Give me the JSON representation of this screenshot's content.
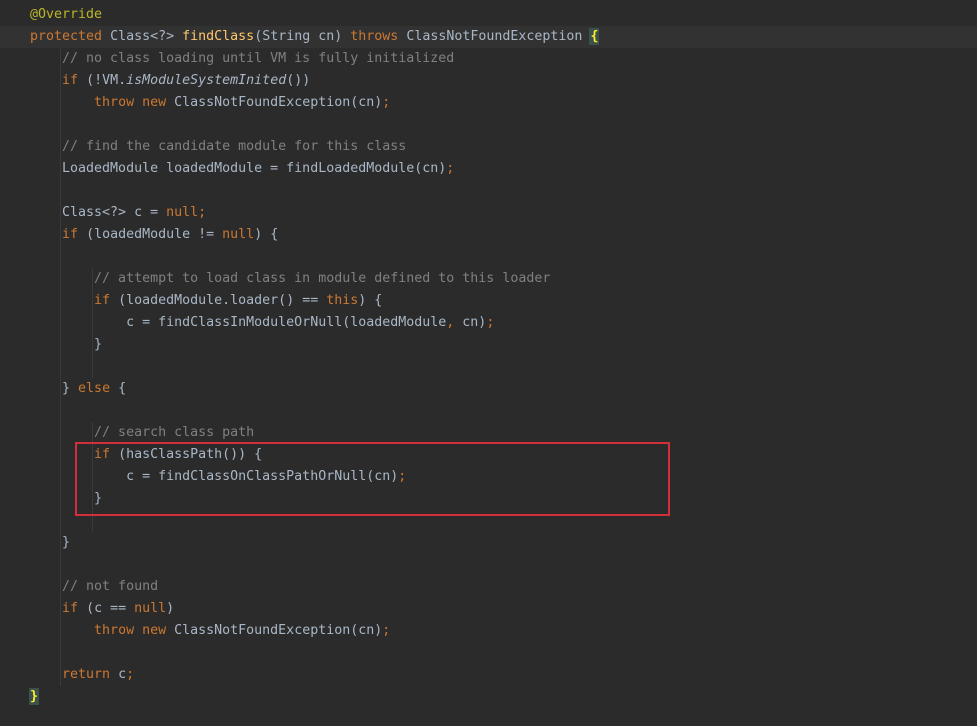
{
  "editor": {
    "lines": [
      [
        {
          "t": "@Override",
          "c": "tok-ann"
        }
      ],
      [
        {
          "t": "protected ",
          "c": "tok-kw"
        },
        {
          "t": "Class<?> ",
          "c": "tok-type"
        },
        {
          "t": "findClass",
          "c": "tok-fn"
        },
        {
          "t": "(String cn) ",
          "c": "tok-plain"
        },
        {
          "t": "throws ",
          "c": "tok-kw"
        },
        {
          "t": "ClassNotFoundException ",
          "c": "tok-plain"
        },
        {
          "t": "{",
          "c": "brace-match"
        }
      ],
      [
        {
          "t": "    // no class loading until VM is fully initialized",
          "c": "tok-cmt"
        }
      ],
      [
        {
          "t": "    ",
          "c": "tok-plain"
        },
        {
          "t": "if ",
          "c": "tok-kw"
        },
        {
          "t": "(!VM.",
          "c": "tok-plain"
        },
        {
          "t": "isModuleSystemInited",
          "c": "tok-plain tok-it"
        },
        {
          "t": "())",
          "c": "tok-plain"
        }
      ],
      [
        {
          "t": "        ",
          "c": "tok-plain"
        },
        {
          "t": "throw new ",
          "c": "tok-kw"
        },
        {
          "t": "ClassNotFoundException(cn)",
          "c": "tok-plain"
        },
        {
          "t": ";",
          "c": "tok-punct"
        }
      ],
      [],
      [
        {
          "t": "    // find the candidate module for this class",
          "c": "tok-cmt"
        }
      ],
      [
        {
          "t": "    LoadedModule loadedModule = findLoadedModule(cn)",
          "c": "tok-plain"
        },
        {
          "t": ";",
          "c": "tok-punct"
        }
      ],
      [],
      [
        {
          "t": "    Class<?> c = ",
          "c": "tok-plain"
        },
        {
          "t": "null;",
          "c": "tok-kw"
        }
      ],
      [
        {
          "t": "    ",
          "c": "tok-plain"
        },
        {
          "t": "if ",
          "c": "tok-kw"
        },
        {
          "t": "(loadedModule != ",
          "c": "tok-plain"
        },
        {
          "t": "null",
          "c": "tok-kw"
        },
        {
          "t": ") {",
          "c": "tok-plain"
        }
      ],
      [],
      [
        {
          "t": "        // attempt to load class in module defined to this loader",
          "c": "tok-cmt"
        }
      ],
      [
        {
          "t": "        ",
          "c": "tok-plain"
        },
        {
          "t": "if ",
          "c": "tok-kw"
        },
        {
          "t": "(loadedModule.loader() == ",
          "c": "tok-plain"
        },
        {
          "t": "this",
          "c": "tok-kw"
        },
        {
          "t": ") {",
          "c": "tok-plain"
        }
      ],
      [
        {
          "t": "            c = findClassInModuleOrNull(loadedModule",
          "c": "tok-plain"
        },
        {
          "t": ", ",
          "c": "tok-punct"
        },
        {
          "t": "cn)",
          "c": "tok-plain"
        },
        {
          "t": ";",
          "c": "tok-punct"
        }
      ],
      [
        {
          "t": "        }",
          "c": "tok-plain"
        }
      ],
      [],
      [
        {
          "t": "    } ",
          "c": "tok-plain"
        },
        {
          "t": "else ",
          "c": "tok-kw"
        },
        {
          "t": "{",
          "c": "tok-plain"
        }
      ],
      [],
      [
        {
          "t": "        // search class path",
          "c": "tok-cmt"
        }
      ],
      [
        {
          "t": "        ",
          "c": "tok-plain"
        },
        {
          "t": "if ",
          "c": "tok-kw"
        },
        {
          "t": "(hasClassPath()) {",
          "c": "tok-plain"
        }
      ],
      [
        {
          "t": "            c = findClassOnClassPathOrNull(cn)",
          "c": "tok-plain"
        },
        {
          "t": ";",
          "c": "tok-punct"
        }
      ],
      [
        {
          "t": "        }",
          "c": "tok-plain"
        }
      ],
      [],
      [
        {
          "t": "    }",
          "c": "tok-plain"
        }
      ],
      [],
      [
        {
          "t": "    // not found",
          "c": "tok-cmt"
        }
      ],
      [
        {
          "t": "    ",
          "c": "tok-plain"
        },
        {
          "t": "if ",
          "c": "tok-kw"
        },
        {
          "t": "(c == ",
          "c": "tok-plain"
        },
        {
          "t": "null",
          "c": "tok-kw"
        },
        {
          "t": ")",
          "c": "tok-plain"
        }
      ],
      [
        {
          "t": "        ",
          "c": "tok-plain"
        },
        {
          "t": "throw new ",
          "c": "tok-kw"
        },
        {
          "t": "ClassNotFoundException(cn)",
          "c": "tok-plain"
        },
        {
          "t": ";",
          "c": "tok-punct"
        }
      ],
      [],
      [
        {
          "t": "    ",
          "c": "tok-plain"
        },
        {
          "t": "return ",
          "c": "tok-kw"
        },
        {
          "t": "c",
          "c": "tok-plain"
        },
        {
          "t": ";",
          "c": "tok-punct"
        }
      ],
      [
        {
          "t": "}",
          "c": "brace-match"
        }
      ]
    ],
    "current_line_index": 1
  },
  "colors": {
    "background": "#2b2b2b",
    "keyword": "#cc7832",
    "annotation": "#bbb529",
    "function": "#ffc66d",
    "comment": "#808080",
    "text": "#a9b7c6",
    "highlight_box": "#d32f3a"
  }
}
